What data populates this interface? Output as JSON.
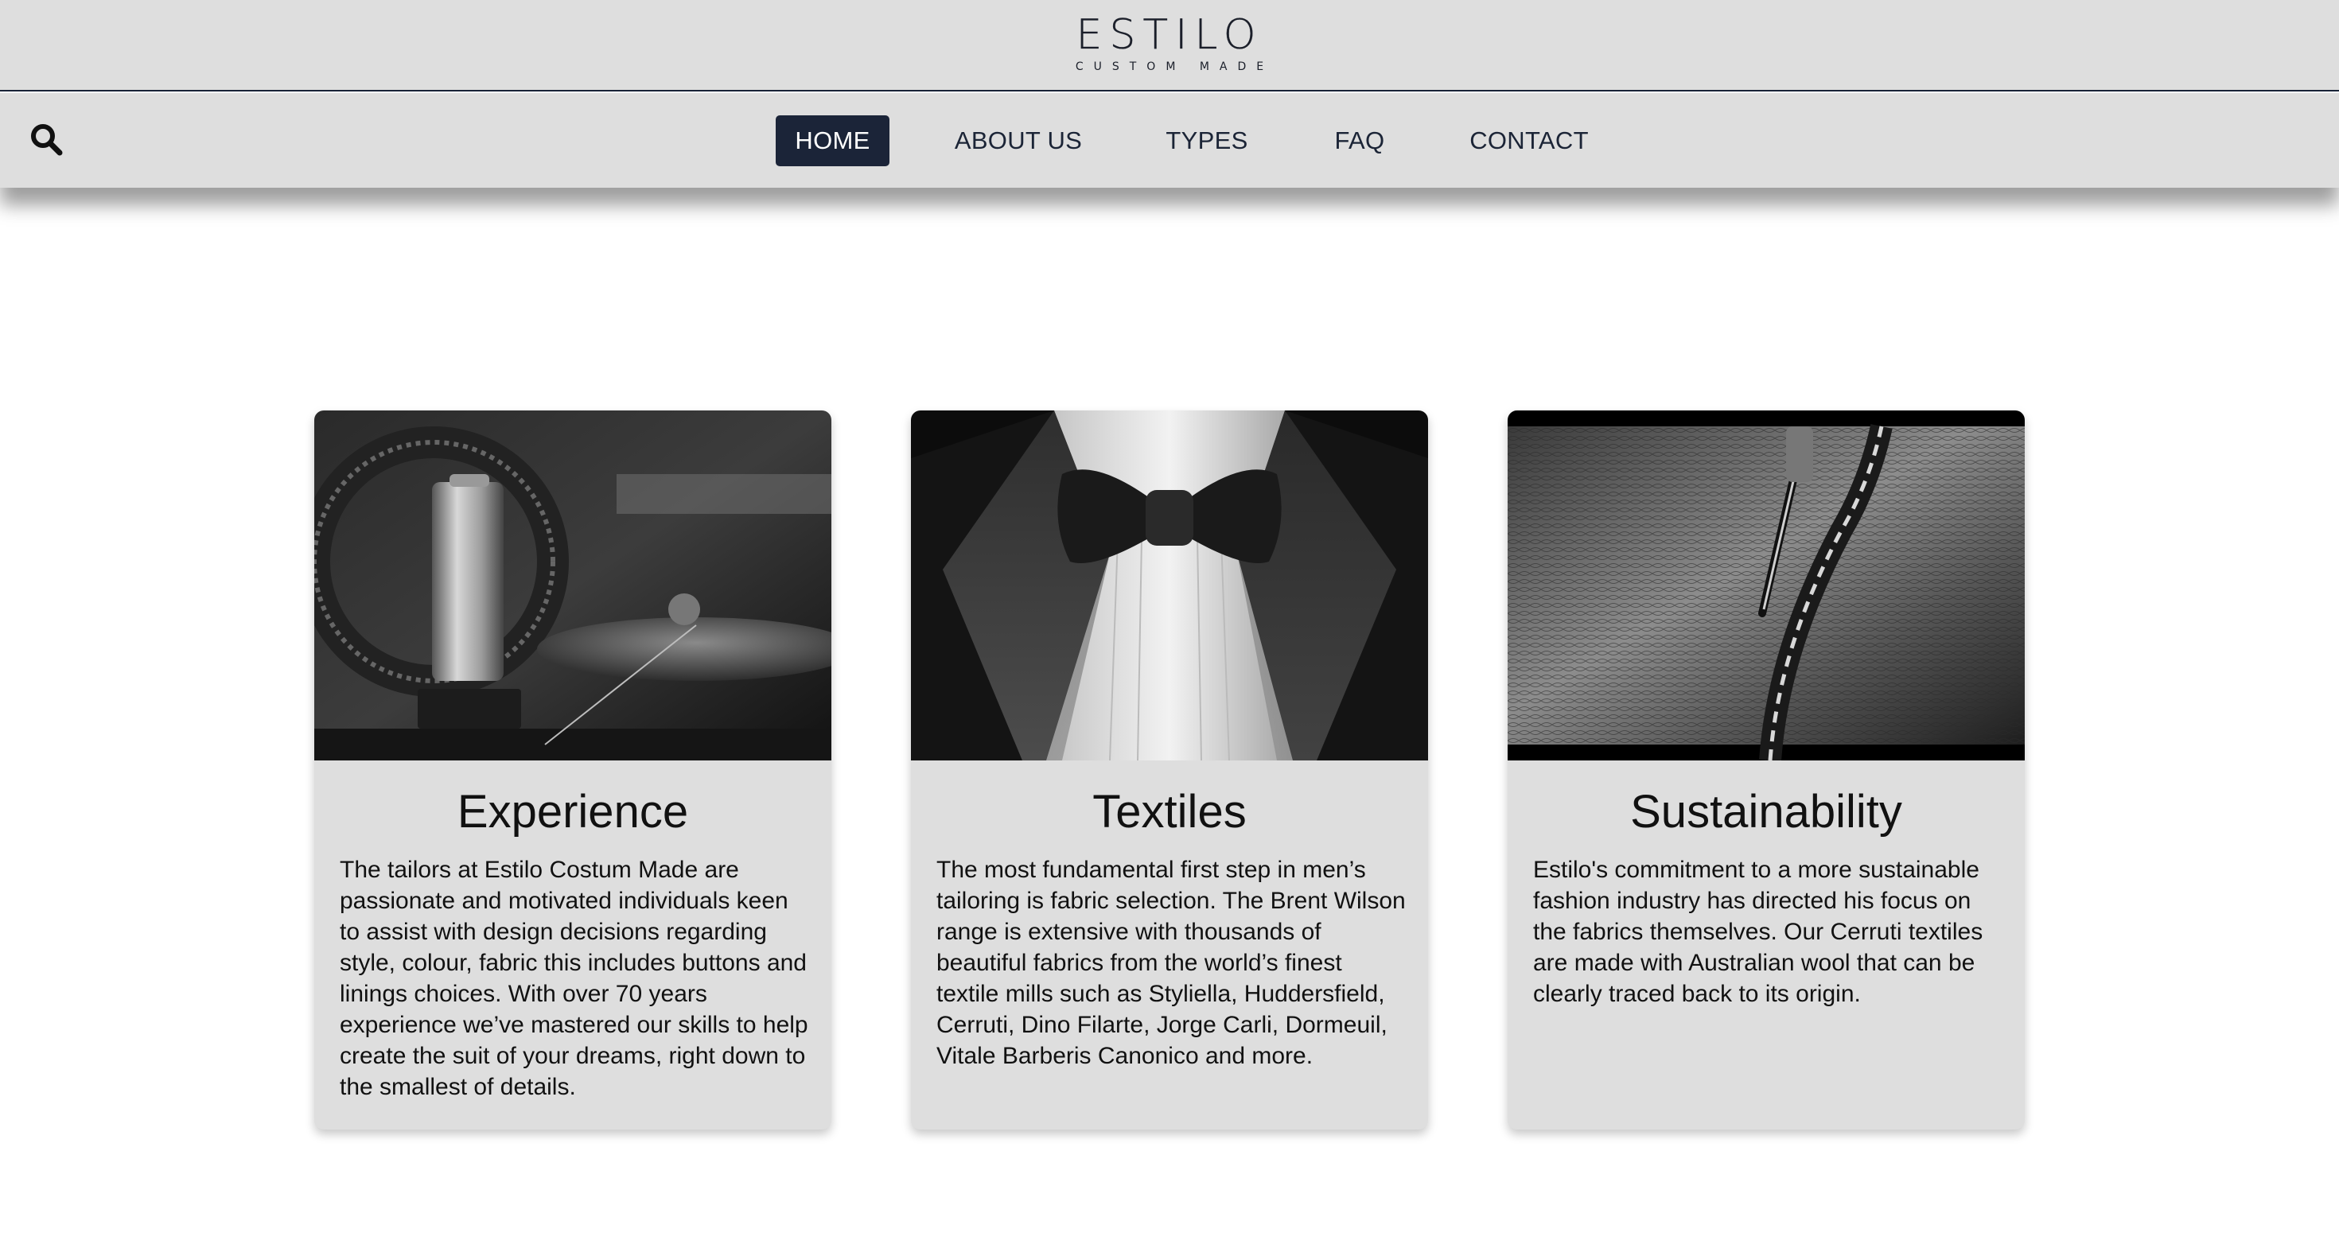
{
  "header": {
    "logo_word": "ESTILO",
    "logo_tagline": "CUSTOM MADE"
  },
  "nav": {
    "search_icon": "search-icon",
    "items": [
      {
        "label": "HOME",
        "active": true
      },
      {
        "label": "ABOUT US",
        "active": false
      },
      {
        "label": "TYPES",
        "active": false
      },
      {
        "label": "FAQ",
        "active": false
      },
      {
        "label": "CONTACT",
        "active": false
      }
    ],
    "active_bg": "#1b2438"
  },
  "cards": [
    {
      "title": "Experience",
      "image": "sewing-machine-spool-photo",
      "text": "The tailors at Estilo Costum Made are passionate and motivated individuals keen to assist with design decisions regarding style, colour, fabric this includes buttons and linings choices. With over 70 years experience we’ve mastered our skills to help create the suit of your dreams, right down to the smallest of details."
    },
    {
      "title": "Textiles",
      "image": "tuxedo-bow-tie-photo",
      "text": "The most fundamental first step in men’s tailoring is fabric selection. The Brent Wilson range is extensive with thousands of beautiful fabrics from the world’s finest textile mills such as Styliella, Huddersfield, Cerruti, Dino Filarte, Jorge Carli, Dormeuil, Vitale Barberis Canonico and more."
    },
    {
      "title": "Sustainability",
      "image": "needle-leather-stitching-photo",
      "text": "Estilo's commitment to a more sustainable fashion industry has directed his focus on the fabrics themselves. Our Cerruti textiles are made with Australian wool that can be clearly traced back to its origin."
    }
  ],
  "colors": {
    "header_bg": "#dedede",
    "card_bg": "#dedede",
    "text": "#111111",
    "brand_navy": "#1b2438"
  }
}
